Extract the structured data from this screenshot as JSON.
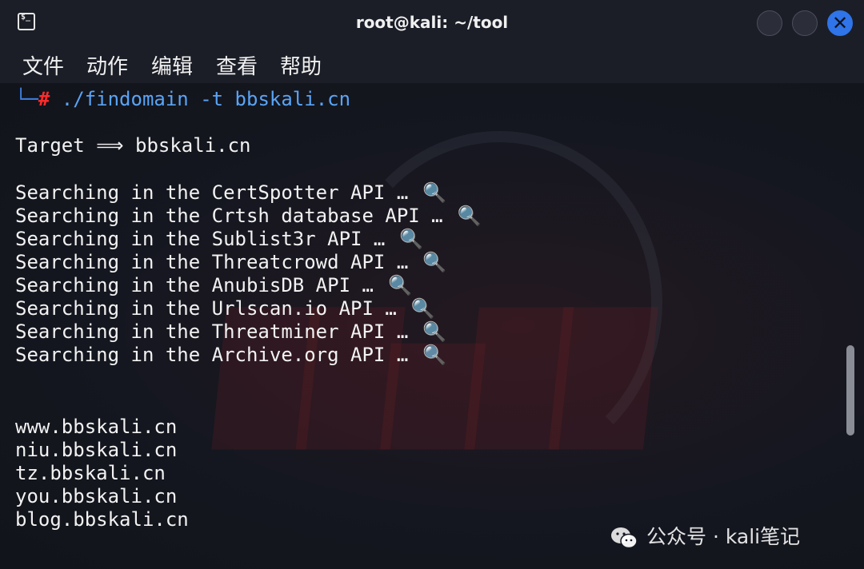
{
  "window": {
    "title": "root@kali: ~/tool"
  },
  "menu": [
    "文件",
    "动作",
    "编辑",
    "查看",
    "帮助"
  ],
  "terminal": {
    "prompt_corner": "└─",
    "prompt_hash": "#",
    "command": " ./findomain -t bbskali.cn",
    "target_line": "Target ⟹ bbskali.cn",
    "searching": [
      "Searching in the CertSpotter API …",
      "Searching in the Crtsh database API …",
      "Searching in the Sublist3r API …",
      "Searching in the Threatcrowd API …",
      "Searching in the AnubisDB API …",
      "Searching in the Urlscan.io API …",
      "Searching in the Threatminer API …",
      "Searching in the Archive.org API …"
    ],
    "search_icon": "🔍",
    "results": [
      "www.bbskali.cn",
      "niu.bbskali.cn",
      "tz.bbskali.cn",
      "you.bbskali.cn",
      "blog.bbskali.cn"
    ]
  },
  "watermark": {
    "text": "公众号 · kali笔记"
  },
  "icons": {
    "terminal": "terminal-icon",
    "wechat": "wechat-icon",
    "close": "close-icon"
  },
  "colors": {
    "prompt_corner": "#3f7fe0",
    "prompt_hash": "#ff2b2b",
    "command": "#5aa4f5",
    "close_button": "#2f74e8"
  }
}
